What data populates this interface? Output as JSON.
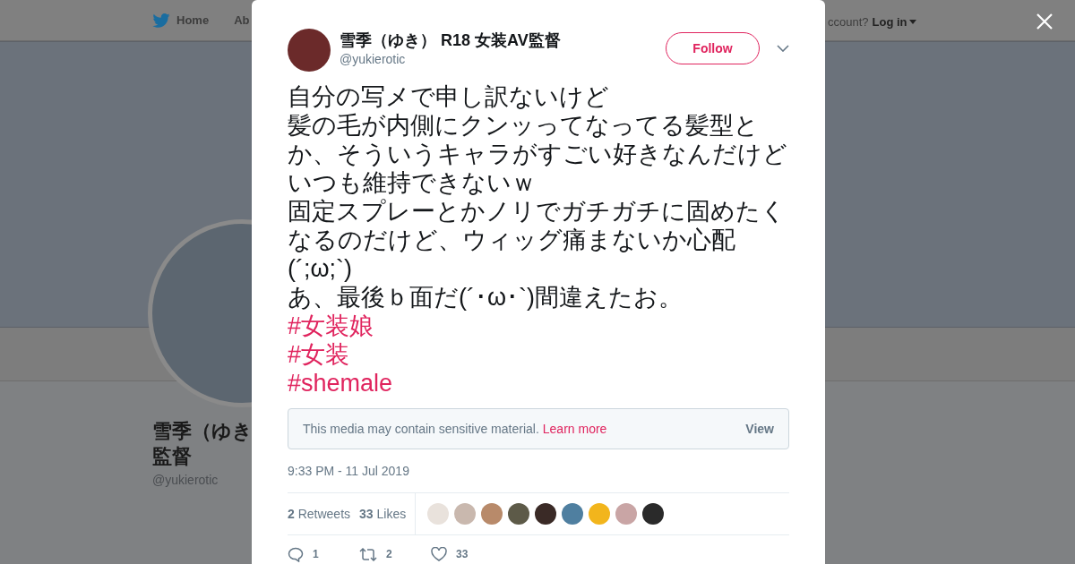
{
  "background_page": {
    "nav": [
      {
        "label": "Home"
      },
      {
        "label": "Ab"
      }
    ],
    "account_prompt": "ccount?",
    "login": "Log in",
    "profile_name_lines": [
      "雪季（ゆき",
      "監督"
    ],
    "profile_handle": "@yukierotic"
  },
  "tweet": {
    "author_name": "雪季（ゆき） R18 女装AV監督",
    "handle": "@yukierotic",
    "follow_button": "Follow",
    "text_paragraphs": [
      "自分の写メで申し訳ないけど",
      "髪の毛が内側にクンッってなってる髪型とか、そういうキャラがすごい好きなんだけどいつも維持できないｗ",
      "固定スプレーとかノリでガチガチに固めたくなるのだけど、ウィッグ痛まないか心配(´;ω;`)",
      "あ、最後ｂ面だ(´･ω･`)間違えたお。"
    ],
    "hashtags": [
      "#女装娘",
      "#女装",
      "#shemale"
    ],
    "media_notice": {
      "text": "This media may contain sensitive material.",
      "link": "Learn more",
      "button": "View"
    },
    "timestamp": "9:33 PM - 11 Jul 2019",
    "stats": [
      "**2** Retweets",
      "**33** Likes"
    ],
    "likers": [
      {
        "color": "#e9e2dc"
      },
      {
        "color": "#c9b8ae"
      },
      {
        "color": "#b88a6a"
      },
      {
        "color": "#5d5a48"
      },
      {
        "color": "#3a2a26"
      },
      {
        "color": "#4f7fa0"
      },
      {
        "color": "#f2b51c"
      },
      {
        "color": "#c9a5a5"
      },
      {
        "color": "#2a2a2a"
      }
    ],
    "actions": [
      {
        "kind": "reply",
        "count": "1"
      },
      {
        "kind": "retweet",
        "count": "2"
      },
      {
        "kind": "like",
        "count": "33"
      }
    ]
  }
}
